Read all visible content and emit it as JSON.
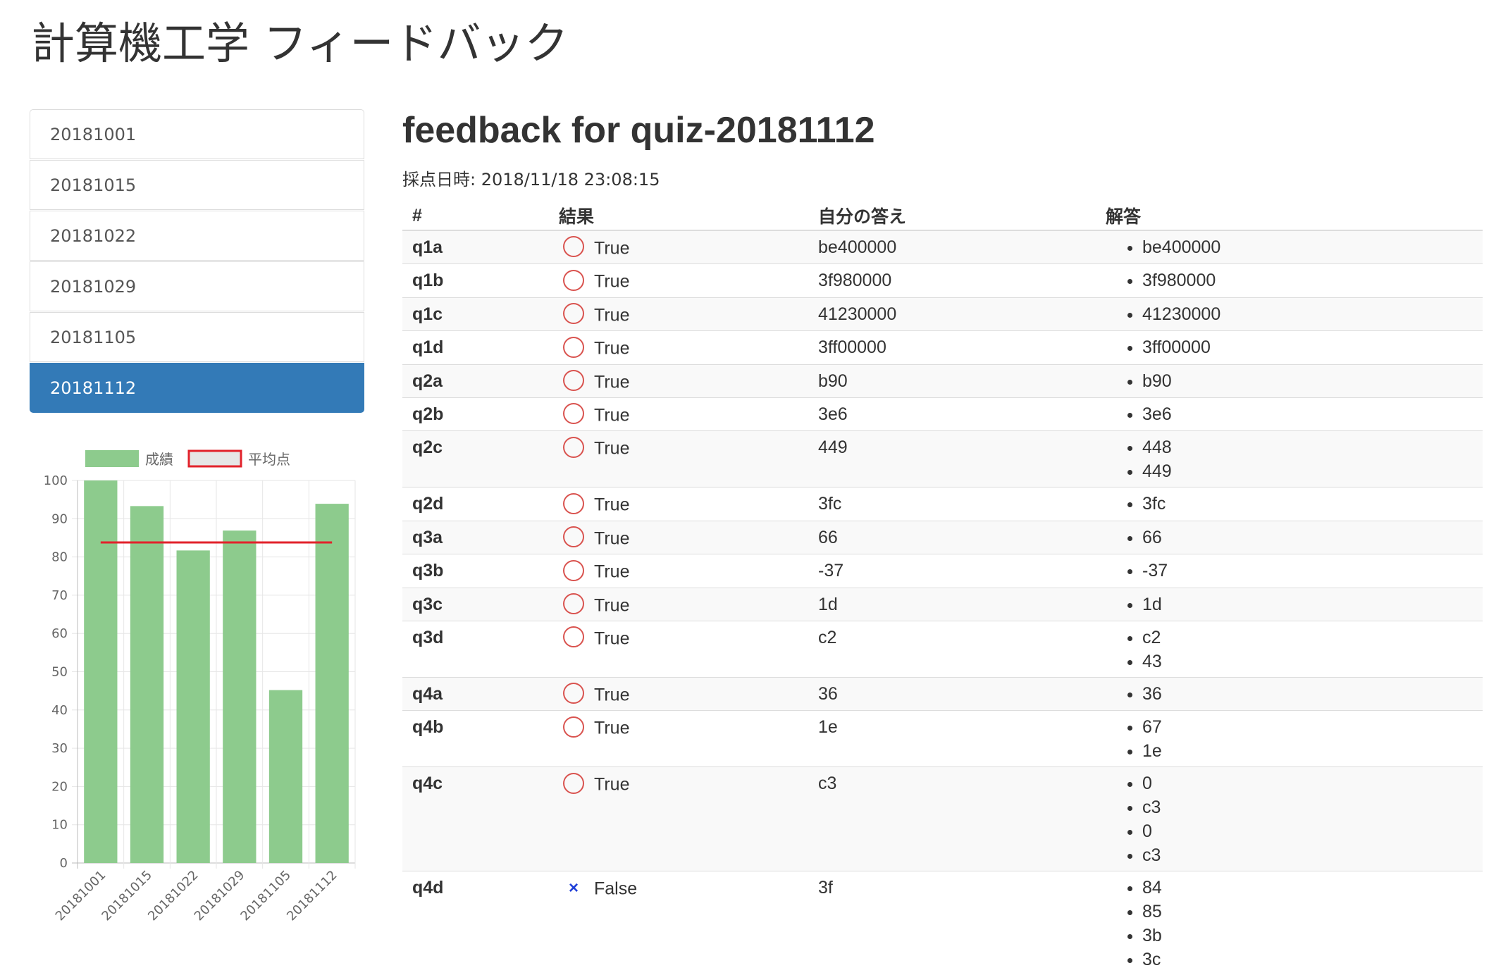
{
  "header": {
    "title": "計算機工学 フィードバック"
  },
  "sidebar": {
    "items": [
      {
        "label": "20181001",
        "active": false
      },
      {
        "label": "20181015",
        "active": false
      },
      {
        "label": "20181022",
        "active": false
      },
      {
        "label": "20181029",
        "active": false
      },
      {
        "label": "20181105",
        "active": false
      },
      {
        "label": "20181112",
        "active": true
      }
    ]
  },
  "colors": {
    "active": "#337ab7",
    "bar": "#8dcb8d",
    "average_line": "#e2222b",
    "false_mark": "#1f3fd8",
    "true_mark": "#d9534f"
  },
  "chart_data": {
    "type": "bar",
    "categories": [
      "20181001",
      "20181015",
      "20181022",
      "20181029",
      "20181105",
      "20181112"
    ],
    "series": [
      {
        "name": "成績",
        "type": "bar",
        "values": [
          100,
          93.3,
          81.7,
          86.9,
          45.2,
          93.9
        ],
        "color": "#8dcb8d"
      },
      {
        "name": "平均点",
        "type": "line",
        "values": [
          83.8,
          83.8,
          83.8,
          83.8,
          83.8,
          83.8
        ],
        "color": "#e2222b"
      }
    ],
    "yticks": [
      0,
      10,
      20,
      30,
      40,
      50,
      60,
      70,
      80,
      90,
      100
    ],
    "ylim": [
      0,
      100
    ],
    "legend": "top",
    "grid": true
  },
  "main": {
    "title": "feedback for quiz-20181112",
    "graded_time": "採点日時: 2018/11/18 23:08:15",
    "columns": [
      "#",
      "結果",
      "自分の答え",
      "解答"
    ],
    "rows": [
      {
        "id": "q1a",
        "result": "True",
        "mine": "be400000",
        "answers": [
          "be400000"
        ]
      },
      {
        "id": "q1b",
        "result": "True",
        "mine": "3f980000",
        "answers": [
          "3f980000"
        ]
      },
      {
        "id": "q1c",
        "result": "True",
        "mine": "41230000",
        "answers": [
          "41230000"
        ]
      },
      {
        "id": "q1d",
        "result": "True",
        "mine": "3ff00000",
        "answers": [
          "3ff00000"
        ]
      },
      {
        "id": "q2a",
        "result": "True",
        "mine": "b90",
        "answers": [
          "b90"
        ]
      },
      {
        "id": "q2b",
        "result": "True",
        "mine": "3e6",
        "answers": [
          "3e6"
        ]
      },
      {
        "id": "q2c",
        "result": "True",
        "mine": "449",
        "answers": [
          "448",
          "449"
        ]
      },
      {
        "id": "q2d",
        "result": "True",
        "mine": "3fc",
        "answers": [
          "3fc"
        ]
      },
      {
        "id": "q3a",
        "result": "True",
        "mine": "66",
        "answers": [
          "66"
        ]
      },
      {
        "id": "q3b",
        "result": "True",
        "mine": "-37",
        "answers": [
          "-37"
        ]
      },
      {
        "id": "q3c",
        "result": "True",
        "mine": "1d",
        "answers": [
          "1d"
        ]
      },
      {
        "id": "q3d",
        "result": "True",
        "mine": "c2",
        "answers": [
          "c2",
          "43"
        ]
      },
      {
        "id": "q4a",
        "result": "True",
        "mine": "36",
        "answers": [
          "36"
        ]
      },
      {
        "id": "q4b",
        "result": "True",
        "mine": "1e",
        "answers": [
          "67",
          "1e"
        ]
      },
      {
        "id": "q4c",
        "result": "True",
        "mine": "c3",
        "answers": [
          "0",
          "c3",
          "0",
          "c3"
        ]
      },
      {
        "id": "q4d",
        "result": "False",
        "mine": "3f",
        "answers": [
          "84",
          "85",
          "3b",
          "3c"
        ]
      }
    ]
  }
}
